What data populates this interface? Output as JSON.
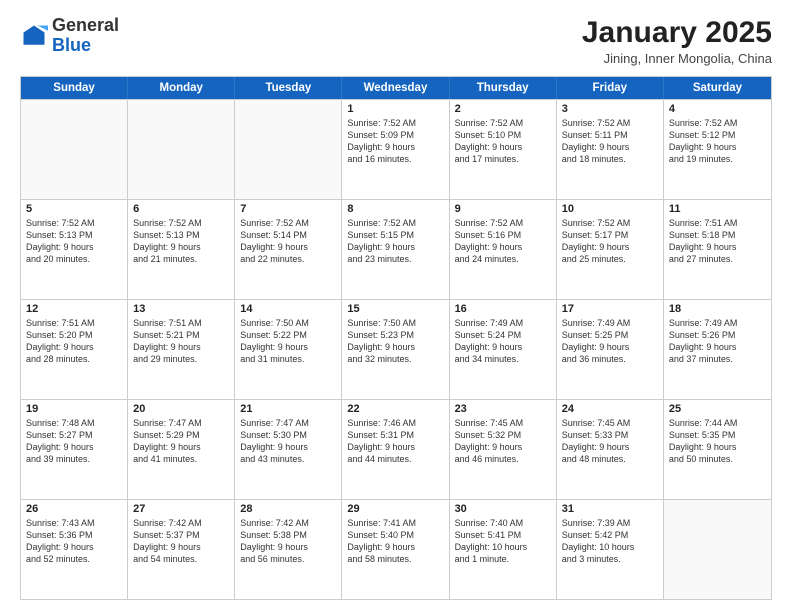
{
  "logo": {
    "general": "General",
    "blue": "Blue"
  },
  "header": {
    "title": "January 2025",
    "subtitle": "Jining, Inner Mongolia, China"
  },
  "days": [
    "Sunday",
    "Monday",
    "Tuesday",
    "Wednesday",
    "Thursday",
    "Friday",
    "Saturday"
  ],
  "weeks": [
    [
      {
        "date": "",
        "info": ""
      },
      {
        "date": "",
        "info": ""
      },
      {
        "date": "",
        "info": ""
      },
      {
        "date": "1",
        "info": "Sunrise: 7:52 AM\nSunset: 5:09 PM\nDaylight: 9 hours\nand 16 minutes."
      },
      {
        "date": "2",
        "info": "Sunrise: 7:52 AM\nSunset: 5:10 PM\nDaylight: 9 hours\nand 17 minutes."
      },
      {
        "date": "3",
        "info": "Sunrise: 7:52 AM\nSunset: 5:11 PM\nDaylight: 9 hours\nand 18 minutes."
      },
      {
        "date": "4",
        "info": "Sunrise: 7:52 AM\nSunset: 5:12 PM\nDaylight: 9 hours\nand 19 minutes."
      }
    ],
    [
      {
        "date": "5",
        "info": "Sunrise: 7:52 AM\nSunset: 5:13 PM\nDaylight: 9 hours\nand 20 minutes."
      },
      {
        "date": "6",
        "info": "Sunrise: 7:52 AM\nSunset: 5:13 PM\nDaylight: 9 hours\nand 21 minutes."
      },
      {
        "date": "7",
        "info": "Sunrise: 7:52 AM\nSunset: 5:14 PM\nDaylight: 9 hours\nand 22 minutes."
      },
      {
        "date": "8",
        "info": "Sunrise: 7:52 AM\nSunset: 5:15 PM\nDaylight: 9 hours\nand 23 minutes."
      },
      {
        "date": "9",
        "info": "Sunrise: 7:52 AM\nSunset: 5:16 PM\nDaylight: 9 hours\nand 24 minutes."
      },
      {
        "date": "10",
        "info": "Sunrise: 7:52 AM\nSunset: 5:17 PM\nDaylight: 9 hours\nand 25 minutes."
      },
      {
        "date": "11",
        "info": "Sunrise: 7:51 AM\nSunset: 5:18 PM\nDaylight: 9 hours\nand 27 minutes."
      }
    ],
    [
      {
        "date": "12",
        "info": "Sunrise: 7:51 AM\nSunset: 5:20 PM\nDaylight: 9 hours\nand 28 minutes."
      },
      {
        "date": "13",
        "info": "Sunrise: 7:51 AM\nSunset: 5:21 PM\nDaylight: 9 hours\nand 29 minutes."
      },
      {
        "date": "14",
        "info": "Sunrise: 7:50 AM\nSunset: 5:22 PM\nDaylight: 9 hours\nand 31 minutes."
      },
      {
        "date": "15",
        "info": "Sunrise: 7:50 AM\nSunset: 5:23 PM\nDaylight: 9 hours\nand 32 minutes."
      },
      {
        "date": "16",
        "info": "Sunrise: 7:49 AM\nSunset: 5:24 PM\nDaylight: 9 hours\nand 34 minutes."
      },
      {
        "date": "17",
        "info": "Sunrise: 7:49 AM\nSunset: 5:25 PM\nDaylight: 9 hours\nand 36 minutes."
      },
      {
        "date": "18",
        "info": "Sunrise: 7:49 AM\nSunset: 5:26 PM\nDaylight: 9 hours\nand 37 minutes."
      }
    ],
    [
      {
        "date": "19",
        "info": "Sunrise: 7:48 AM\nSunset: 5:27 PM\nDaylight: 9 hours\nand 39 minutes."
      },
      {
        "date": "20",
        "info": "Sunrise: 7:47 AM\nSunset: 5:29 PM\nDaylight: 9 hours\nand 41 minutes."
      },
      {
        "date": "21",
        "info": "Sunrise: 7:47 AM\nSunset: 5:30 PM\nDaylight: 9 hours\nand 43 minutes."
      },
      {
        "date": "22",
        "info": "Sunrise: 7:46 AM\nSunset: 5:31 PM\nDaylight: 9 hours\nand 44 minutes."
      },
      {
        "date": "23",
        "info": "Sunrise: 7:45 AM\nSunset: 5:32 PM\nDaylight: 9 hours\nand 46 minutes."
      },
      {
        "date": "24",
        "info": "Sunrise: 7:45 AM\nSunset: 5:33 PM\nDaylight: 9 hours\nand 48 minutes."
      },
      {
        "date": "25",
        "info": "Sunrise: 7:44 AM\nSunset: 5:35 PM\nDaylight: 9 hours\nand 50 minutes."
      }
    ],
    [
      {
        "date": "26",
        "info": "Sunrise: 7:43 AM\nSunset: 5:36 PM\nDaylight: 9 hours\nand 52 minutes."
      },
      {
        "date": "27",
        "info": "Sunrise: 7:42 AM\nSunset: 5:37 PM\nDaylight: 9 hours\nand 54 minutes."
      },
      {
        "date": "28",
        "info": "Sunrise: 7:42 AM\nSunset: 5:38 PM\nDaylight: 9 hours\nand 56 minutes."
      },
      {
        "date": "29",
        "info": "Sunrise: 7:41 AM\nSunset: 5:40 PM\nDaylight: 9 hours\nand 58 minutes."
      },
      {
        "date": "30",
        "info": "Sunrise: 7:40 AM\nSunset: 5:41 PM\nDaylight: 10 hours\nand 1 minute."
      },
      {
        "date": "31",
        "info": "Sunrise: 7:39 AM\nSunset: 5:42 PM\nDaylight: 10 hours\nand 3 minutes."
      },
      {
        "date": "",
        "info": ""
      }
    ]
  ]
}
